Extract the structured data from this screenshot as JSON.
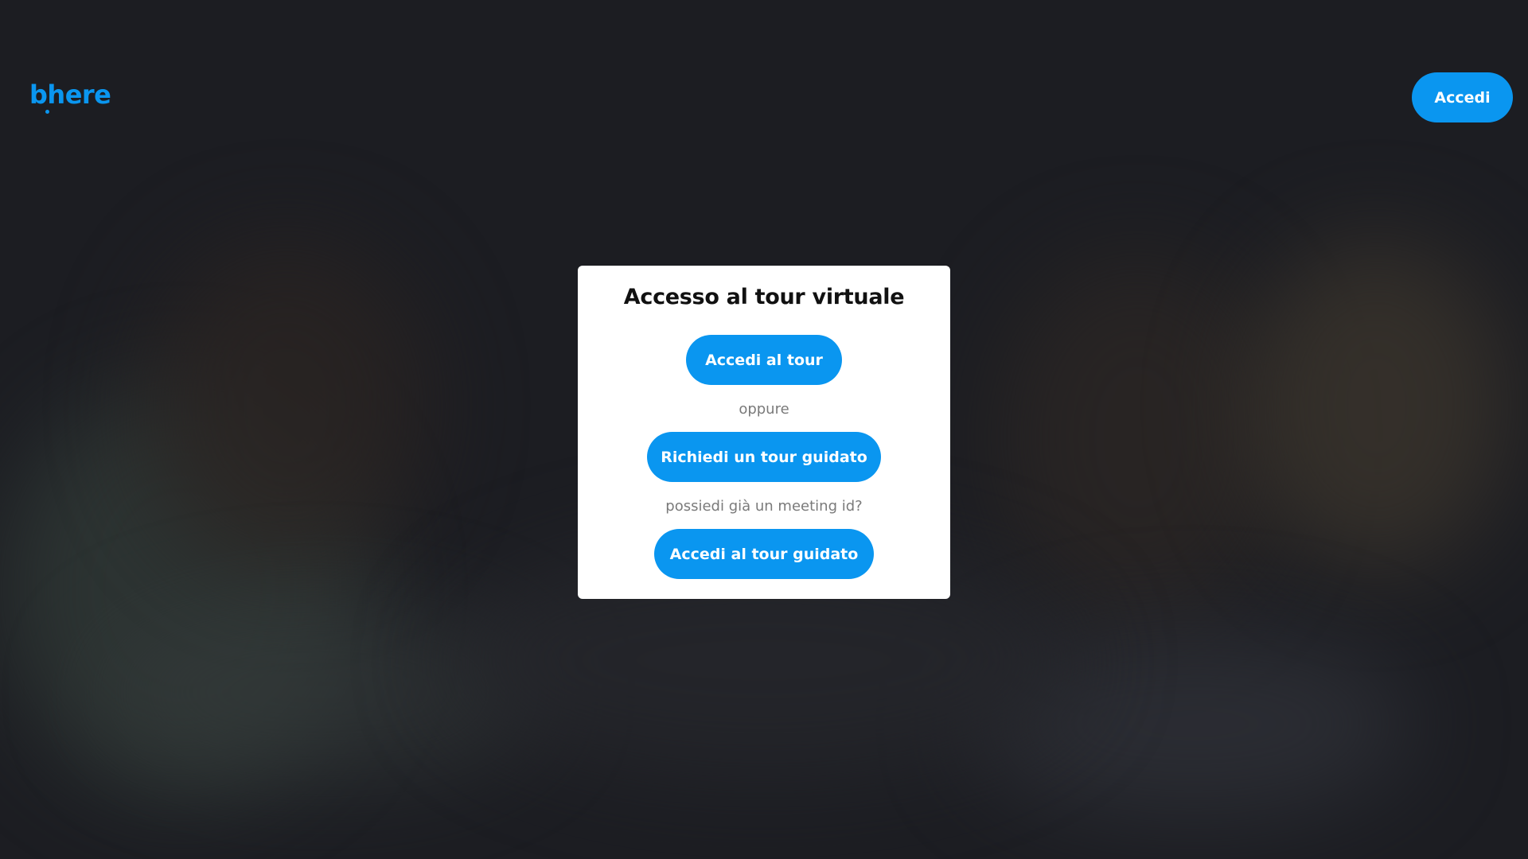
{
  "brand": {
    "logo_text": "bhere",
    "accent_color": "#0a96f0"
  },
  "header": {
    "login_label": "Accedi"
  },
  "modal": {
    "title": "Accesso al tour virtuale",
    "enter_tour_label": "Accedi al tour",
    "separator_or": "oppure",
    "request_guided_label": "Richiedi un tour guidato",
    "meeting_prompt": "possiedi già un meeting id?",
    "enter_guided_label": "Accedi al tour guidato"
  }
}
